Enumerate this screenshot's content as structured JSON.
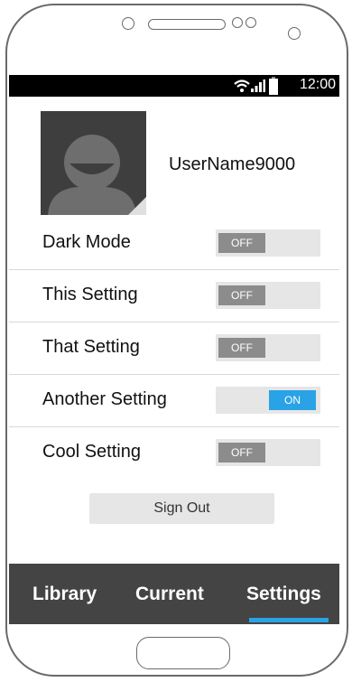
{
  "status_bar": {
    "time": "12:00"
  },
  "profile": {
    "username": "UserName9000"
  },
  "settings": [
    {
      "label": "Dark Mode",
      "state": "OFF"
    },
    {
      "label": "This Setting",
      "state": "OFF"
    },
    {
      "label": "That Setting",
      "state": "OFF"
    },
    {
      "label": "Another Setting",
      "state": "ON"
    },
    {
      "label": "Cool Setting",
      "state": "OFF"
    }
  ],
  "sign_out_label": "Sign Out",
  "nav": {
    "tabs": [
      "Library",
      "Current",
      "Settings"
    ],
    "active": "Settings"
  },
  "colors": {
    "accent": "#29a3e6",
    "toggle_off_knob": "#8c8c8c",
    "nav_background": "#444444",
    "status_bar": "#000000"
  },
  "icons": [
    "wifi-icon",
    "signal-icon",
    "battery-icon",
    "avatar-person-icon"
  ]
}
